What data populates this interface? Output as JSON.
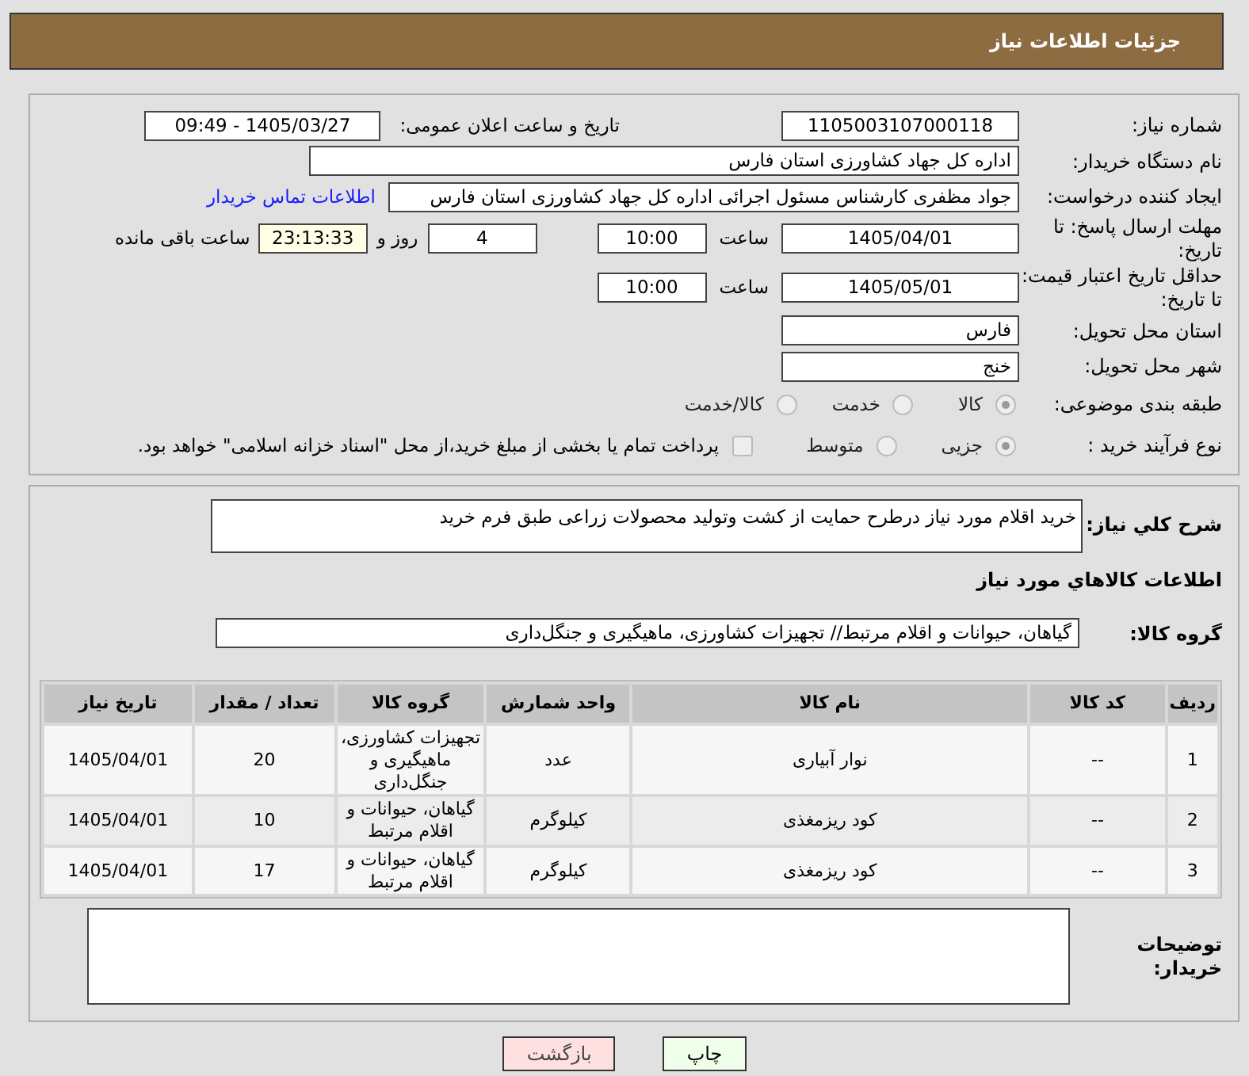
{
  "header": {
    "title": "جزئیات اطلاعات نیاز"
  },
  "need_number": {
    "label": "شماره نیاز:",
    "value": "1105003107000118"
  },
  "announce": {
    "label": "تاریخ و ساعت اعلان عمومی:",
    "value": "1405/03/27 - 09:49"
  },
  "buyer_org": {
    "label": "نام دستگاه خریدار:",
    "value": "اداره کل جهاد کشاورزی استان فارس"
  },
  "requester": {
    "label": "ایجاد کننده درخواست:",
    "value": "جواد مظفری کارشناس مسئول اجرائی اداره کل جهاد کشاورزی استان فارس",
    "link": "اطلاعات تماس خریدار"
  },
  "deadline": {
    "label": "مهلت ارسال پاسخ: تا تاریخ:",
    "date": "1405/04/01",
    "time_label": "ساعت",
    "time": "10:00",
    "days": "4",
    "days_label": "روز و",
    "remaining": "23:13:33",
    "remaining_label": "ساعت باقی مانده"
  },
  "validity": {
    "label": "حداقل تاریخ اعتبار قیمت: تا تاریخ:",
    "date": "1405/05/01",
    "time_label": "ساعت",
    "time": "10:00"
  },
  "province": {
    "label": "استان محل تحویل:",
    "value": "فارس"
  },
  "city": {
    "label": "شهر محل تحویل:",
    "value": "خنج"
  },
  "category": {
    "label": "طبقه بندی موضوعی:",
    "options": [
      {
        "label": "کالا",
        "selected": true
      },
      {
        "label": "خدمت",
        "selected": false
      },
      {
        "label": "کالا/خدمت",
        "selected": false
      }
    ]
  },
  "process": {
    "label": "نوع فرآیند خرید :",
    "options": [
      {
        "label": "جزیی",
        "selected": true
      },
      {
        "label": "متوسط",
        "selected": false
      }
    ],
    "payment": {
      "label": "پرداخت تمام یا بخشی از مبلغ خرید،از محل \"اسناد خزانه اسلامی\" خواهد بود.",
      "checked": false
    }
  },
  "description": {
    "label": "شرح کلي نیاز:",
    "value": "خرید اقلام مورد نیاز درطرح حمایت از کشت وتولید محصولات زراعی طبق فرم خرید"
  },
  "goods_title": "اطلاعات کالاهاي مورد نیاز",
  "goods_group": {
    "label": "گروه کالا:",
    "value": "گیاهان، حیوانات و اقلام مرتبط// تجهیزات کشاورزی، ماهیگیری و جنگل‌داری"
  },
  "table": {
    "columns": [
      "ردیف",
      "کد کالا",
      "نام کالا",
      "واحد شمارش",
      "گروه کالا",
      "تعداد / مقدار",
      "تاریخ نیاز"
    ],
    "rows": [
      [
        "1",
        "--",
        "نوار آبیاری",
        "عدد",
        "تجهیزات کشاورزی، ماهیگیری و جنگل‌داری",
        "20",
        "1405/04/01"
      ],
      [
        "2",
        "--",
        "کود ریزمغذی",
        "کیلوگرم",
        "گیاهان، حیوانات و اقلام مرتبط",
        "10",
        "1405/04/01"
      ],
      [
        "3",
        "--",
        "کود ریزمغذی",
        "کیلوگرم",
        "گیاهان، حیوانات و اقلام مرتبط",
        "17",
        "1405/04/01"
      ]
    ]
  },
  "buyer_notes": {
    "label": "توضیحات خریدار:"
  },
  "buttons": [
    {
      "label": "چاپ",
      "kind": "print"
    },
    {
      "label": "بازگشت",
      "kind": "back"
    }
  ]
}
